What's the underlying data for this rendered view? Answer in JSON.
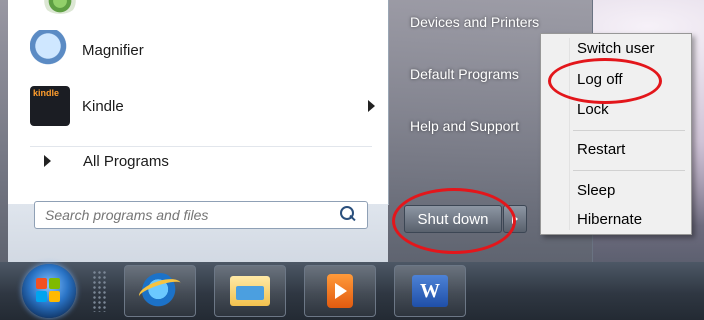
{
  "start_menu": {
    "programs": [
      {
        "label": "Magnifier",
        "icon": "magnifier-icon"
      },
      {
        "label": "Kindle",
        "icon": "kindle-icon",
        "icon_text": "kindle"
      }
    ],
    "all_programs_label": "All Programs",
    "search": {
      "placeholder": "Search programs and files"
    },
    "right_pane": {
      "devices_printers": "Devices and Printers",
      "default_programs": "Default Programs",
      "help_support": "Help and Support"
    },
    "shutdown_label": "Shut down"
  },
  "power_menu": {
    "items": [
      "Switch user",
      "Log off",
      "Lock",
      "Restart",
      "Sleep",
      "Hibernate"
    ]
  },
  "taskbar": {
    "word_letter": "W"
  },
  "colors": {
    "highlight": "#e3161b"
  }
}
